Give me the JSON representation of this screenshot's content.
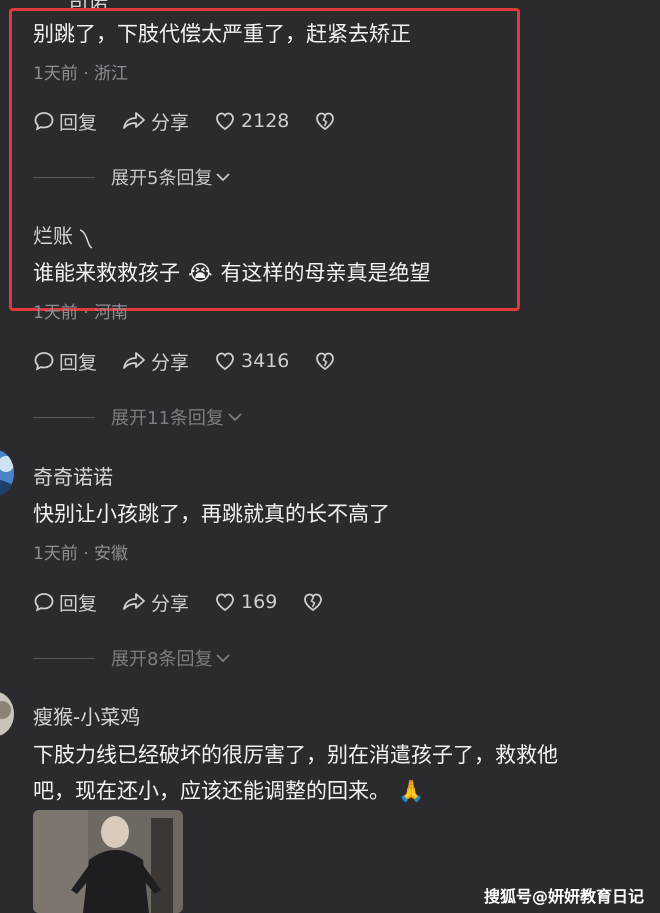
{
  "top_partial_username": "司诺",
  "comment1": {
    "text": "别跳了，下肢代偿太严重了，赶紧去矫正",
    "meta": "1天前 · 浙江",
    "reply": "回复",
    "share": "分享",
    "likes": "2128",
    "expand": "展开5条回复"
  },
  "comment2": {
    "username": "烂账",
    "text": "谁能来救救孩子",
    "emoji": "😭",
    "text2": "有这样的母亲真是绝望",
    "meta": "1天前 · 河南",
    "reply": "回复",
    "share": "分享",
    "likes": "3416",
    "expand": "展开11条回复"
  },
  "comment3": {
    "username": "奇奇诺诺",
    "text": "快别让小孩跳了，再跳就真的长不高了",
    "meta": "1天前 · 安徽",
    "reply": "回复",
    "share": "分享",
    "likes": "169",
    "expand": "展开8条回复"
  },
  "comment4": {
    "username": "瘦猴-小菜鸡",
    "text_line1": "下肢力线已经破坏的很厉害了，别在消遣孩子了，救救他",
    "text_line2": "吧，现在还小，应该还能调整的回来。",
    "emoji": "🙏"
  },
  "watermark": "搜狐号@妍妍教育日记",
  "colors": {
    "highlight": "#e03a3a",
    "background": "#2b2a2e"
  }
}
